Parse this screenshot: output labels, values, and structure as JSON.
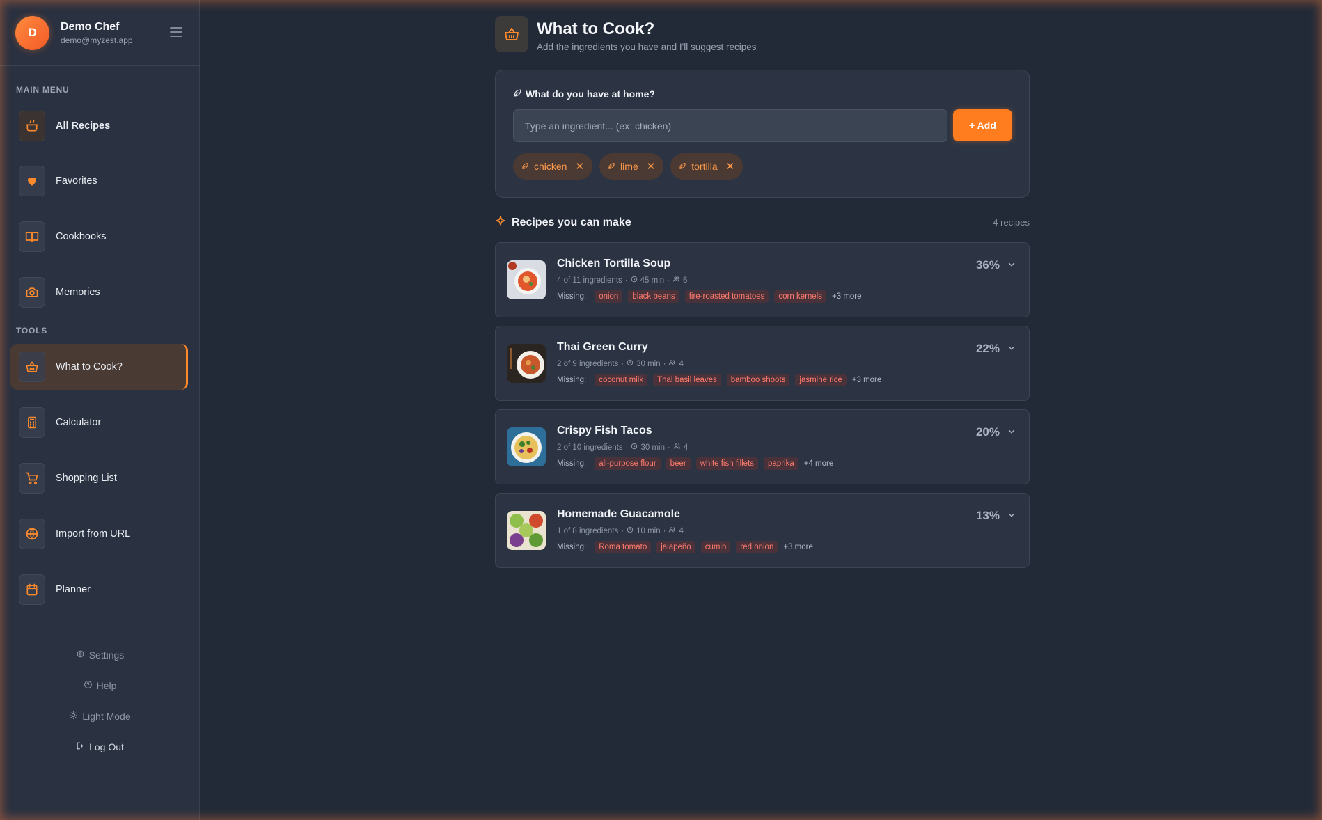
{
  "user": {
    "initial": "D",
    "name": "Demo Chef",
    "email": "demo@myzest.app"
  },
  "sidebar": {
    "main_menu_label": "MAIN MENU",
    "tools_label": "TOOLS",
    "main_items": [
      {
        "label": "All Recipes",
        "icon": "pot-icon"
      },
      {
        "label": "Favorites",
        "icon": "heart-icon"
      },
      {
        "label": "Cookbooks",
        "icon": "book-icon"
      },
      {
        "label": "Memories",
        "icon": "camera-icon"
      }
    ],
    "tool_items": [
      {
        "label": "What to Cook?",
        "icon": "basket-icon"
      },
      {
        "label": "Calculator",
        "icon": "calculator-icon"
      },
      {
        "label": "Shopping List",
        "icon": "cart-icon"
      },
      {
        "label": "Import from URL",
        "icon": "globe-icon"
      },
      {
        "label": "Planner",
        "icon": "calendar-icon"
      }
    ],
    "footer": {
      "settings": "Settings",
      "help": "Help",
      "light_mode": "Light Mode",
      "logout": "Log Out"
    }
  },
  "page": {
    "title": "What to Cook?",
    "subtitle": "Add the ingredients you have and I'll suggest recipes"
  },
  "ingredients": {
    "prompt": "What do you have at home?",
    "input_placeholder": "Type an ingredient... (ex: chicken)",
    "add_label": "+ Add",
    "chips": [
      "chicken",
      "lime",
      "tortilla"
    ]
  },
  "results": {
    "title": "Recipes you can make",
    "count": "4 recipes",
    "missing_label": "Missing:",
    "recipes": [
      {
        "name": "Chicken Tortilla Soup",
        "ingredients": "4 of 11 ingredients",
        "time": "45 min",
        "servings": "6",
        "missing": [
          "onion",
          "black beans",
          "fire-roasted tomatoes",
          "corn kernels"
        ],
        "more": "+3 more",
        "match": "36%"
      },
      {
        "name": "Thai Green Curry",
        "ingredients": "2 of 9 ingredients",
        "time": "30 min",
        "servings": "4",
        "missing": [
          "coconut milk",
          "Thai basil leaves",
          "bamboo shoots",
          "jasmine rice"
        ],
        "more": "+3 more",
        "match": "22%"
      },
      {
        "name": "Crispy Fish Tacos",
        "ingredients": "2 of 10 ingredients",
        "time": "30 min",
        "servings": "4",
        "missing": [
          "all-purpose flour",
          "beer",
          "white fish fillets",
          "paprika"
        ],
        "more": "+4 more",
        "match": "20%"
      },
      {
        "name": "Homemade Guacamole",
        "ingredients": "1 of 8 ingredients",
        "time": "10 min",
        "servings": "4",
        "missing": [
          "Roma tomato",
          "jalapeño",
          "cumin",
          "red onion"
        ],
        "more": "+3 more",
        "match": "13%"
      }
    ]
  },
  "colors": {
    "accent": "#ff7d1f",
    "background": "#232a37",
    "sidebar": "#2a3140",
    "missing_tag": "#ff7b6e"
  }
}
